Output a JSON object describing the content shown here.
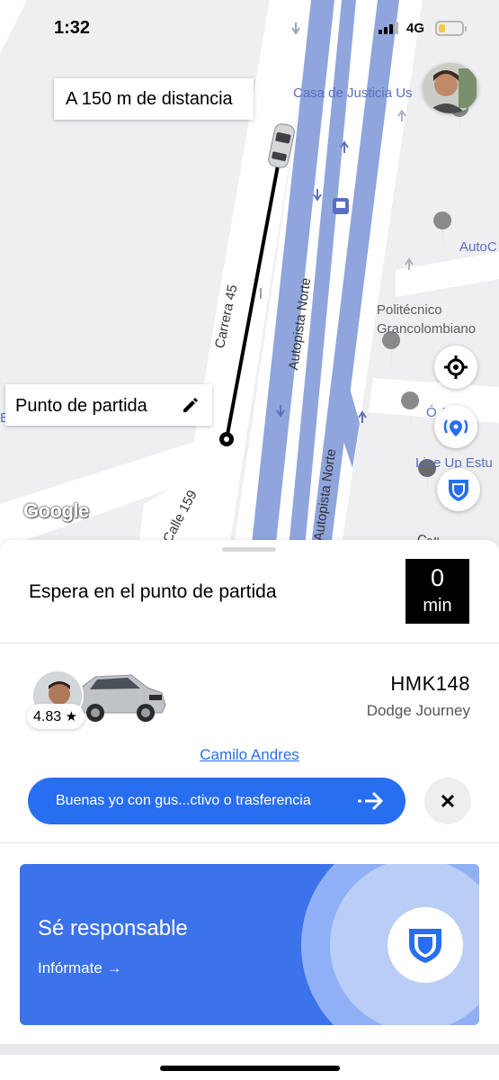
{
  "status_bar": {
    "time": "1:32",
    "network": "4G",
    "battery_color": "#f2c94c"
  },
  "map": {
    "distance_label": "A 150 m de distancia",
    "pickup_label": "Punto de partida",
    "pickup_edit_icon": "pencil-icon",
    "roads": {
      "carrera": "Carrera 45",
      "autopista_1": "Autopista Norte",
      "autopista_2": "Autopista Norte",
      "calle": "Calle 159",
      "calle_partial": "Calle"
    },
    "places": {
      "casa_justicia": "Casa de Justicia Us",
      "autoc": "AutoC",
      "politecnico_1": "Politécnico",
      "politecnico_2": "Grancolombiano",
      "abu": "Ó Ab",
      "line_up": "Line Up Estu",
      "left_letter": "El"
    },
    "google_logo": "Google",
    "buttons": {
      "locate_icon": "crosshair-icon",
      "share_icon": "broadcast-icon",
      "safety_icon": "shield-icon"
    },
    "colors": {
      "highway": "#8fa5dc",
      "route": "#000000",
      "accent": "#276ef1"
    }
  },
  "sheet": {
    "wait_text": "Espera en el punto de partida",
    "eta_number": "0",
    "eta_unit": "min",
    "driver": {
      "rating": "4.83",
      "rating_icon": "star-icon",
      "plate": "HMK148",
      "car_model": "Dodge Journey",
      "name": "Camilo Andres"
    },
    "message": {
      "text": "Buenas yo con gus...ctivo o trasferencia",
      "send_icon": "arrow-right-icon",
      "close_icon": "close-icon"
    },
    "safety_card": {
      "title": "Sé responsable",
      "link": "Infórmate →",
      "icon": "shield-icon",
      "color": "#3c72ea"
    }
  }
}
